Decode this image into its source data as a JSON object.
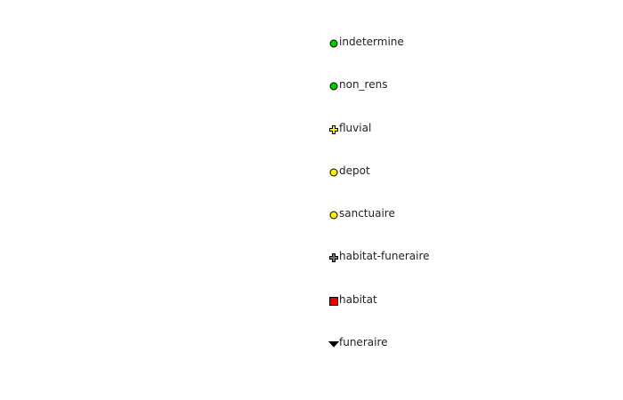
{
  "legend": {
    "items": [
      {
        "label": "indetermine",
        "symbol": "circle",
        "color": "#00cc00"
      },
      {
        "label": "non_rens",
        "symbol": "circle",
        "color": "#00cc00"
      },
      {
        "label": "fluvial",
        "symbol": "cross",
        "color": "#ffee00"
      },
      {
        "label": "depot",
        "symbol": "circle",
        "color": "#ffee00"
      },
      {
        "label": "sanctuaire",
        "symbol": "circle",
        "color": "#ffee00"
      },
      {
        "label": "habitat-funeraire",
        "symbol": "cross",
        "color": "#777777"
      },
      {
        "label": "habitat",
        "symbol": "square",
        "color": "#ee0000"
      },
      {
        "label": "funeraire",
        "symbol": "triangle-down",
        "color": "#000000"
      }
    ]
  }
}
